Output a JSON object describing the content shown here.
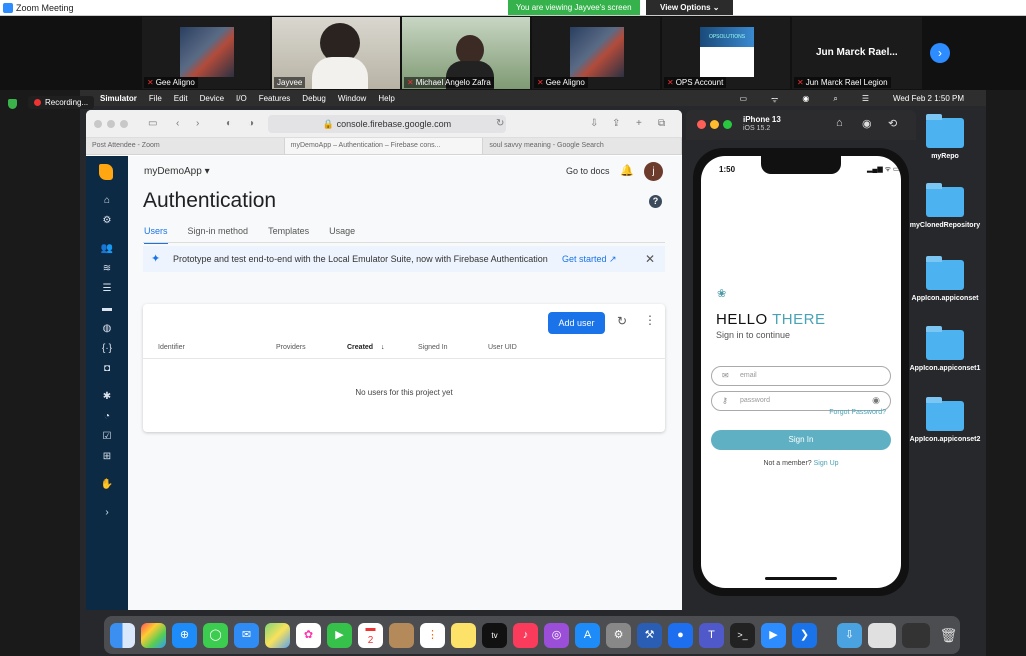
{
  "zoom": {
    "window_title": "Zoom Meeting",
    "viewing_banner": "You are viewing Jayvee's screen",
    "view_options": "View Options ⌄",
    "participants": [
      {
        "name": "Gee Aligno"
      },
      {
        "name": "Jayvee"
      },
      {
        "name": "Michael Angelo Zafra"
      },
      {
        "name": "Gee Aligno"
      },
      {
        "name": "OPS Account"
      },
      {
        "name": "Jun Marck Rael Legion",
        "big_label": "Jun Marck Rael..."
      }
    ],
    "ops_logo_text": "OPSOLUTIONS",
    "recording": "Recording..."
  },
  "menubar": {
    "items": [
      "Simulator",
      "File",
      "Edit",
      "Device",
      "I/O",
      "Features",
      "Debug",
      "Window",
      "Help"
    ],
    "clock": "Wed Feb 2  1:50 PM"
  },
  "browser": {
    "url": "console.firebase.google.com",
    "tabs": [
      "Post Attendee - Zoom",
      "myDemoApp – Authentication – Firebase cons...",
      "soul savvy meaning - Google Search"
    ]
  },
  "firebase": {
    "project": "myDemoApp ▾",
    "go_to_docs": "Go to docs",
    "avatar_letter": "j",
    "title": "Authentication",
    "subtabs": [
      "Users",
      "Sign-in method",
      "Templates",
      "Usage"
    ],
    "banner_message": "Prototype and test end-to-end with the Local Emulator Suite, now with Firebase Authentication",
    "banner_cta": "Get started",
    "add_user": "Add user",
    "columns": [
      "Identifier",
      "Providers",
      "Created",
      "Signed In",
      "User UID"
    ],
    "empty_message": "No users for this project yet"
  },
  "simulator": {
    "device": "iPhone 13",
    "os": "iOS 15.2",
    "time": "1:50",
    "status": "▂▄▆ ᯤ ▭",
    "app": {
      "hello": "HELLO",
      "there": "THERE",
      "subtitle": "Sign in to continue",
      "email_placeholder": "email",
      "password_placeholder": "password",
      "forgot": "Forgot Password?",
      "signin": "Sign In",
      "not_member": "Not a member?",
      "signup": "Sign Up"
    }
  },
  "desktop": {
    "folders": [
      "myRepo",
      "myClonedRepository",
      "AppIcon.appiconset",
      "AppIcon.appiconset1",
      "AppIcon.appiconset2"
    ]
  },
  "colors": {
    "firebase_rail": "#0d2a45",
    "primary_blue": "#1a73e8",
    "accent_teal": "#4aa3b5",
    "zoom_green": "#35b24b"
  }
}
